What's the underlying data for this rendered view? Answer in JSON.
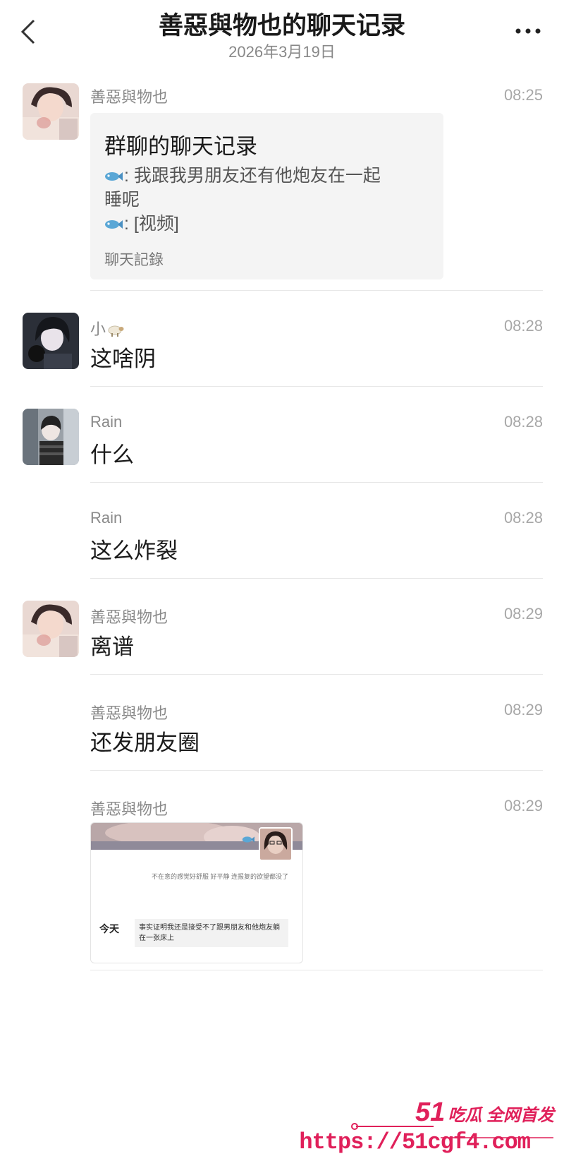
{
  "header": {
    "title": "善惡與物也的聊天记录",
    "date": "2026年3月19日"
  },
  "messages": [
    {
      "sender": "善惡與物也",
      "time": "08:25",
      "card": {
        "title": "群聊的聊天记录",
        "line1_prefix": ":",
        "line1": "我跟我男朋友还有他炮友在一起",
        "line1_cont": "睡呢",
        "line2_prefix": ":",
        "line2": "[视频]",
        "footer": "聊天記錄"
      }
    },
    {
      "sender": "小",
      "time": "08:28",
      "text": "这啥阴"
    },
    {
      "sender": "Rain",
      "time": "08:28",
      "text": "什么"
    },
    {
      "sender": "Rain",
      "time": "08:28",
      "text": "这么炸裂"
    },
    {
      "sender": "善惡與物也",
      "time": "08:29",
      "text": "离谱"
    },
    {
      "sender": "善惡與物也",
      "time": "08:29",
      "text": "还发朋友圈"
    },
    {
      "sender": "善惡與物也",
      "time": "08:29",
      "image": {
        "caption": "不在意的感觉好舒服 好平静 连报复的欲望都没了",
        "day_label": "今天",
        "post_text": "事实证明我还是接受不了跟男朋友和他炮友躺在一张床上"
      }
    }
  ],
  "watermark": {
    "logo_num": "51",
    "logo_text": "吃瓜 全网首发",
    "url": "https://51cgf4.com"
  },
  "colors": {
    "accent": "#e0205a",
    "divider": "#e7e7e7",
    "card_bg": "#f4f4f4"
  },
  "icons": [
    "back-chevron-icon",
    "more-dots-icon",
    "fish-emoji-icon",
    "sheep-emoji-icon"
  ]
}
